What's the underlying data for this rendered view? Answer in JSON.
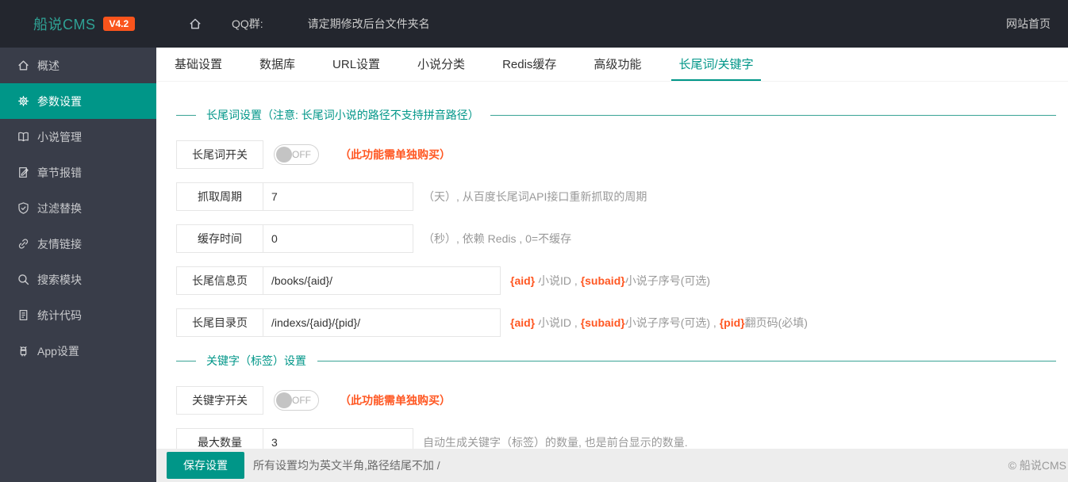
{
  "colors": {
    "accent": "#009688",
    "orange": "#FF5722",
    "topbar_bg": "#23262E",
    "sidebar_bg": "#393D49",
    "logo_teal": "#2FA295",
    "badge_orange": "#FA541C"
  },
  "topbar": {
    "logo": "船说CMS",
    "version": "V4.2",
    "home_icon": "home-icon",
    "qq_label": "QQ群:",
    "notice": "请定期修改后台文件夹名",
    "site_link": "网站首页"
  },
  "sidebar": {
    "items": [
      {
        "label": "概述",
        "icon": "home-icon",
        "active": false
      },
      {
        "label": "参数设置",
        "icon": "gear-icon",
        "active": true
      },
      {
        "label": "小说管理",
        "icon": "book-icon",
        "active": false
      },
      {
        "label": "章节报错",
        "icon": "report-edit-icon",
        "active": false
      },
      {
        "label": "过滤替换",
        "icon": "shield-check-icon",
        "active": false
      },
      {
        "label": "友情链接",
        "icon": "link-icon",
        "active": false
      },
      {
        "label": "搜索模块",
        "icon": "search-icon",
        "active": false
      },
      {
        "label": "统计代码",
        "icon": "code-doc-icon",
        "active": false
      },
      {
        "label": "App设置",
        "icon": "android-icon",
        "active": false
      }
    ]
  },
  "tabs": [
    {
      "label": "基础设置",
      "active": false
    },
    {
      "label": "数据库",
      "active": false
    },
    {
      "label": "URL设置",
      "active": false
    },
    {
      "label": "小说分类",
      "active": false
    },
    {
      "label": "Redis缓存",
      "active": false
    },
    {
      "label": "高级功能",
      "active": false
    },
    {
      "label": "长尾词/关键字",
      "active": true
    }
  ],
  "sections": [
    {
      "title": "长尾词设置（注意: 长尾词小说的路径不支持拼音路径）",
      "rows": [
        {
          "type": "toggle",
          "label": "长尾词开关",
          "state": "OFF",
          "note": "（此功能需单独购买）"
        },
        {
          "type": "input",
          "label": "抓取周期",
          "value": "7",
          "hint": "（天）, 从百度长尾词API接口重新抓取的周期"
        },
        {
          "type": "input",
          "label": "缓存时间",
          "value": "0",
          "hint": "（秒）, 依赖 Redis , 0=不缓存"
        },
        {
          "type": "input",
          "label": "长尾信息页",
          "value": "/books/{aid}/",
          "hint_parts": [
            {
              "text": "{aid}",
              "em": true
            },
            {
              "text": " 小说ID , ",
              "em": false
            },
            {
              "text": "{subaid}",
              "em": true
            },
            {
              "text": "小说子序号(可选)",
              "em": false
            }
          ]
        },
        {
          "type": "input",
          "label": "长尾目录页",
          "value": "/indexs/{aid}/{pid}/",
          "hint_parts": [
            {
              "text": "{aid}",
              "em": true
            },
            {
              "text": " 小说ID , ",
              "em": false
            },
            {
              "text": "{subaid}",
              "em": true
            },
            {
              "text": "小说子序号(可选) , ",
              "em": false
            },
            {
              "text": "{pid}",
              "em": true
            },
            {
              "text": "翻页码(必填)",
              "em": false
            }
          ]
        }
      ]
    },
    {
      "title": "关键字（标签）设置",
      "rows": [
        {
          "type": "toggle",
          "label": "关键字开关",
          "state": "OFF",
          "note": "（此功能需单独购买）"
        },
        {
          "type": "input",
          "label": "最大数量",
          "value": "3",
          "hint": "自动生成关键字（标签）的数量, 也是前台显示的数量."
        }
      ]
    }
  ],
  "footer": {
    "save_label": "保存设置",
    "hint": "所有设置均为英文半角,路径结尾不加 /",
    "copyright": "© 船说CMS"
  }
}
